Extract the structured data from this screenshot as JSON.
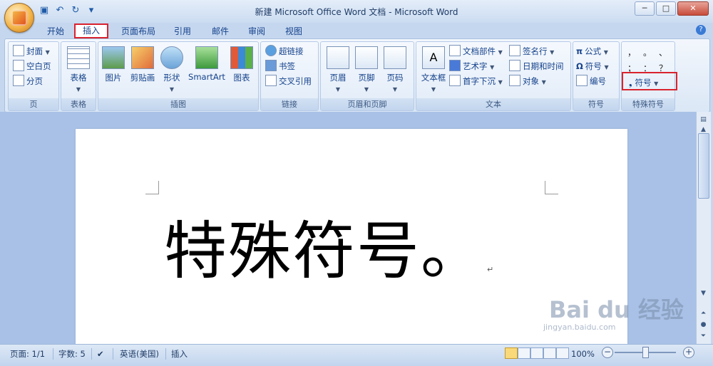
{
  "window": {
    "title": "新建 Microsoft Office Word 文档 - Microsoft Word"
  },
  "qat": {
    "save_icon": "save-icon",
    "undo_icon": "undo-icon",
    "redo_icon": "redo-icon",
    "customize_icon": "customize-icon"
  },
  "tabs": [
    {
      "label": "开始"
    },
    {
      "label": "插入",
      "active": true
    },
    {
      "label": "页面布局"
    },
    {
      "label": "引用"
    },
    {
      "label": "邮件"
    },
    {
      "label": "审阅"
    },
    {
      "label": "视图"
    }
  ],
  "groups": {
    "page": {
      "label": "页",
      "items": [
        "封面",
        "空白页",
        "分页"
      ]
    },
    "table": {
      "label": "表格",
      "button": "表格"
    },
    "illustrations": {
      "label": "插图",
      "buttons": [
        "图片",
        "剪贴画",
        "形状",
        "SmartArt",
        "图表"
      ]
    },
    "links": {
      "label": "链接",
      "items": [
        "超链接",
        "书签",
        "交叉引用"
      ]
    },
    "header_footer": {
      "label": "页眉和页脚",
      "buttons": [
        "页眉",
        "页脚",
        "页码"
      ]
    },
    "text": {
      "label": "文本",
      "big": "文本框",
      "items": [
        "文档部件",
        "艺术字",
        "首字下沉",
        "签名行",
        "日期和时间",
        "对象"
      ]
    },
    "symbols": {
      "label": "符号",
      "items": [
        "公式",
        "符号",
        "编号"
      ]
    },
    "special": {
      "label": "特殊符号",
      "glyphs": [
        "，",
        "。",
        "、",
        "；",
        "：",
        "？"
      ],
      "button": "符号"
    }
  },
  "document": {
    "text": "特殊符号。"
  },
  "status": {
    "page": "页面: 1/1",
    "words": "字数: 5",
    "language": "英语(美国)",
    "mode": "插入",
    "zoom": "100%"
  },
  "watermark": {
    "brand": "Bai du 经验",
    "url": "jingyan.baidu.com"
  },
  "colors": {
    "highlight": "#d9232e",
    "ribbon_text": "#15428b"
  }
}
